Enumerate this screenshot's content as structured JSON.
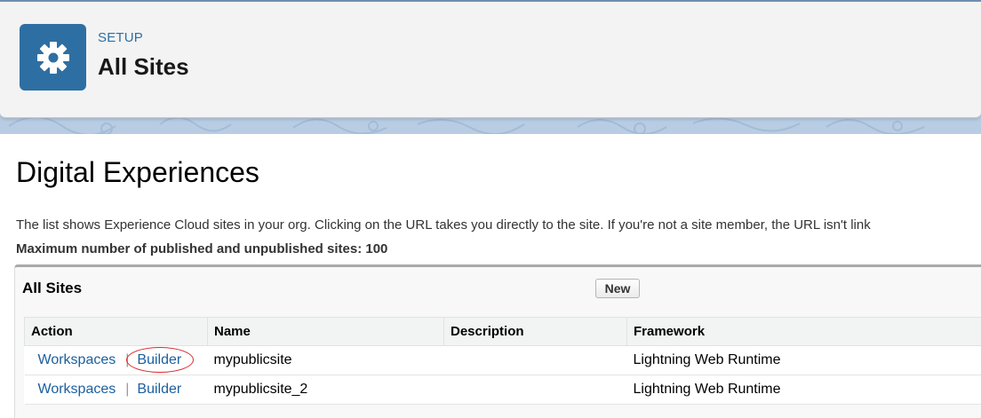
{
  "header": {
    "eyebrow": "SETUP",
    "title": "All Sites",
    "icon": "gear-icon",
    "icon_bg": "#2e6fa3"
  },
  "page": {
    "title": "Digital Experiences",
    "description": "The list shows Experience Cloud sites in your org. Clicking on the URL takes you directly to the site. If you're not a site member, the URL isn't link",
    "max_sites_line": "Maximum number of published and unpublished sites: 100"
  },
  "panel": {
    "title": "All Sites",
    "new_button": "New",
    "columns": [
      "Action",
      "Name",
      "Description",
      "Framework"
    ],
    "rows": [
      {
        "workspaces": "Workspaces",
        "separator": "|",
        "builder": "Builder",
        "name": "mypublicsite",
        "description": "",
        "framework": "Lightning Web Runtime",
        "builder_circled": true
      },
      {
        "workspaces": "Workspaces",
        "separator": "|",
        "builder": "Builder",
        "name": "mypublicsite_2",
        "description": "",
        "framework": "Lightning Web Runtime",
        "builder_circled": false
      }
    ]
  },
  "colors": {
    "link": "#1b5f9e",
    "annotation": "#d8282a",
    "banner": "#b8cde3"
  }
}
